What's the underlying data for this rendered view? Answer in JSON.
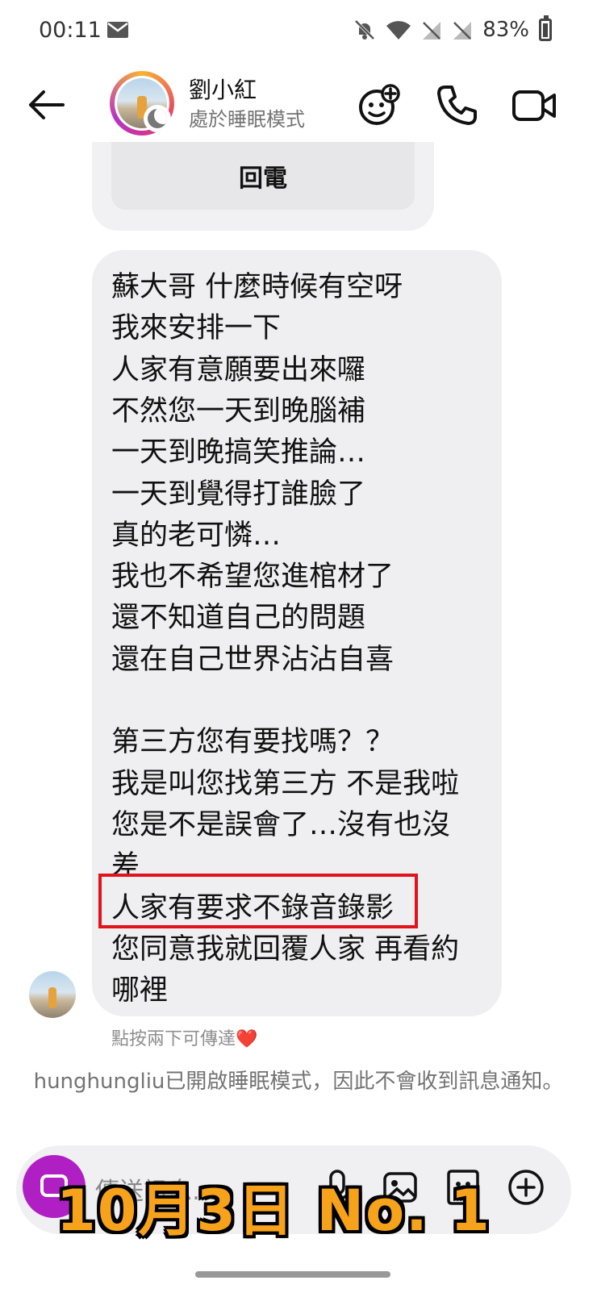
{
  "status_bar": {
    "time": "00:11",
    "battery": "83%",
    "battery_level": 0.83,
    "icons": [
      "mail-icon",
      "mute-icon",
      "wifi-icon",
      "no-signal-icon",
      "no-signal-icon",
      "battery-icon"
    ]
  },
  "header": {
    "contact_name": "劉小紅",
    "contact_status": "處於睡眠模式",
    "icons": [
      "back-arrow-icon",
      "sticker-game-icon",
      "phone-icon",
      "video-icon"
    ]
  },
  "previous_message": {
    "button_label": "回電"
  },
  "message": {
    "lines": [
      "蘇大哥 什麼時候有空呀",
      "我來安排一下",
      "人家有意願要出來囉",
      "不然您一天到晚腦補",
      "一天到晚搞笑推論…",
      "一天到覺得打誰臉了",
      "真的老可憐…",
      "我也不希望您進棺材了",
      "還不知道自己的問題",
      "還在自己世界沾沾自喜",
      "",
      "第三方您有要找嗎？？",
      "我是叫您找第三方 不是我啦",
      "您是不是誤會了…沒有也沒",
      "差",
      "人家有要求不錄音錄影",
      "您同意我就回覆人家 再看約",
      "哪裡"
    ],
    "highlighted_line": "人家有要求不錄音錄影",
    "highlight_color": "#e1141d"
  },
  "hint": "點按兩下可傳達❤️",
  "sleep_notice": "hunghungliu已開啟睡眠模式，因此不會收到訊息通知。",
  "composer": {
    "placeholder": "傳送訊息…",
    "icons": [
      "camera-icon",
      "mic-icon",
      "image-icon",
      "sticker-icon",
      "plus-icon"
    ],
    "camera_color": "#b01fc4"
  },
  "overlay_caption": "10月3日  No. 1",
  "overlay_color": "#f7a21b"
}
